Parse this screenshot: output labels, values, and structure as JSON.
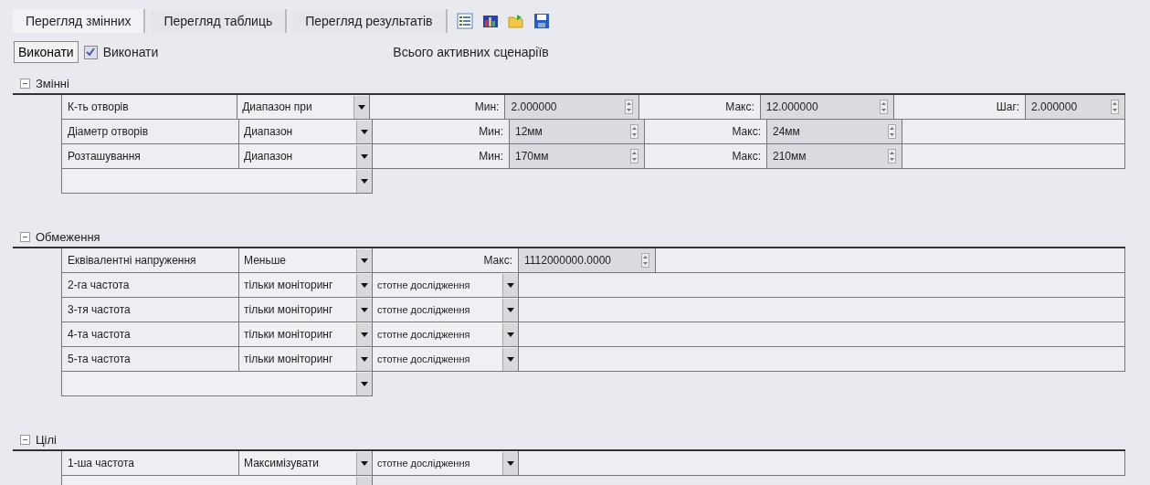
{
  "tabs": [
    {
      "label": "Перегляд змінних",
      "selected": true
    },
    {
      "label": "Перегляд таблиць",
      "selected": false
    },
    {
      "label": "Перегляд результатів",
      "selected": false
    }
  ],
  "toolbar": {
    "run_button": "Виконати",
    "run_checkbox": {
      "label": "Виконати",
      "checked": true
    },
    "scenarios_label": "Всього активних сценаріїв"
  },
  "sections": [
    {
      "title": "Змінні",
      "expanded": true,
      "rows": [
        {
          "kind": "range",
          "name": "К-ть отворів",
          "mode": "Диапазон при",
          "min_label": "Мин:",
          "min": "2.000000",
          "max_label": "Макс:",
          "max": "12.000000",
          "step_label": "Шаг:",
          "step": "2.000000"
        },
        {
          "kind": "range",
          "name": "Діаметр отворів",
          "mode": "Диапазон",
          "min_label": "Мин:",
          "min": "12мм",
          "max_label": "Макс:",
          "max": "24мм"
        },
        {
          "kind": "range",
          "name": "Розташування",
          "mode": "Диапазон",
          "min_label": "Мин:",
          "min": "170мм",
          "max_label": "Макс:",
          "max": "210мм"
        },
        {
          "kind": "add"
        }
      ]
    },
    {
      "title": "Обмеження",
      "expanded": true,
      "rows": [
        {
          "kind": "limit",
          "name": "Еквівалентні напруження",
          "mode": "Меньше",
          "bound_label": "Макс:",
          "bound": "1112000000.0000"
        },
        {
          "kind": "monitor",
          "name": "2-га частота",
          "mode": "тільки моніторинг",
          "option": "стотне дослідження"
        },
        {
          "kind": "monitor",
          "name": "3-тя частота",
          "mode": "тільки моніторинг",
          "option": "стотне дослідження"
        },
        {
          "kind": "monitor",
          "name": "4-та частота",
          "mode": "тільки моніторинг",
          "option": "стотне дослідження"
        },
        {
          "kind": "monitor",
          "name": "5-та частота",
          "mode": "тільки моніторинг",
          "option": "стотне дослідження"
        },
        {
          "kind": "add"
        }
      ]
    },
    {
      "title": "Цілі",
      "expanded": true,
      "rows": [
        {
          "kind": "monitor",
          "name": "1-ша частота",
          "mode": "Максимізувати",
          "option": "стотне дослідження"
        },
        {
          "kind": "add"
        }
      ]
    }
  ]
}
